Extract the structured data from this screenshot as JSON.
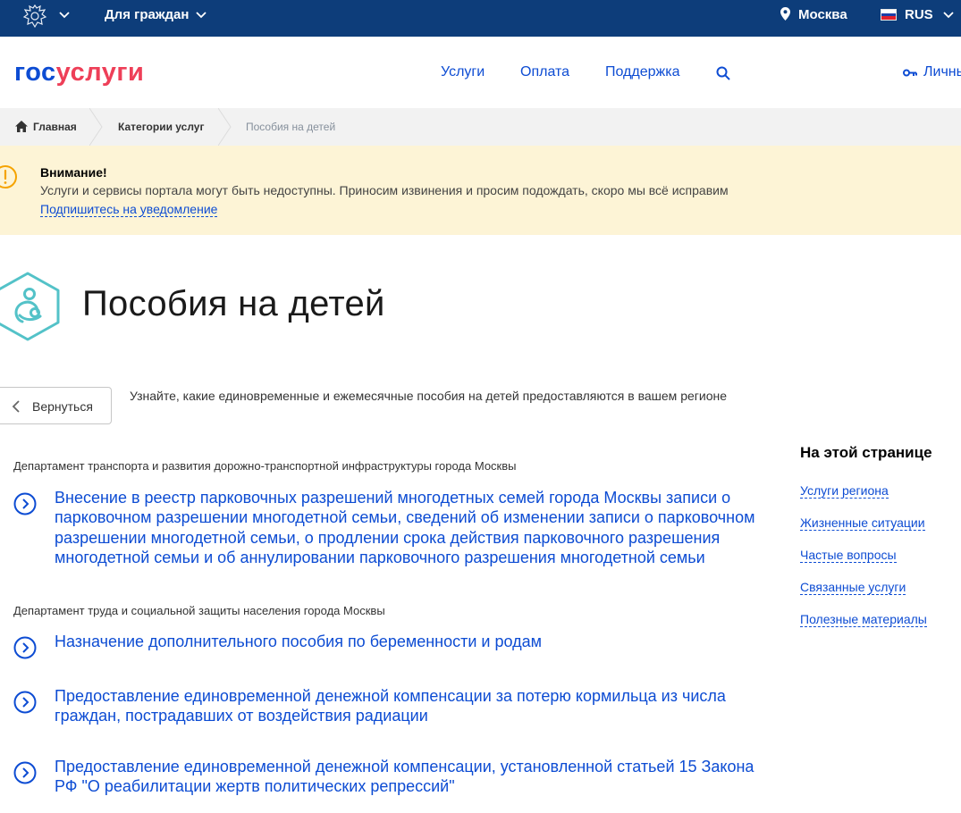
{
  "topbar": {
    "audience": "Для граждан",
    "location": "Москва",
    "language": "RUS",
    "flag_colors": [
      "#ffffff",
      "#1c3fa8",
      "#e2202c"
    ]
  },
  "header": {
    "logo_part1": "гос",
    "logo_part2": "услуги",
    "nav": {
      "services": "Услуги",
      "payment": "Оплата",
      "support": "Поддержка"
    },
    "personal": "Личный"
  },
  "breadcrumbs": {
    "home": "Главная",
    "categories": "Категории услуг",
    "current": "Пособия на детей"
  },
  "alert": {
    "title": "Внимание!",
    "text": "Услуги и сервисы портала могут быть недоступны. Приносим извинения и просим подождать, скоро мы всё исправим",
    "link": "Подпишитесь на уведомление"
  },
  "page": {
    "title": "Пособия на детей",
    "back_label": "Вернуться",
    "lead": "Узнайте, какие единовременные и ежемесячные пособия на детей предоставляются в вашем регионе"
  },
  "departments": [
    {
      "name": "Департамент транспорта и развития дорожно-транспортной инфраструктуры города Москвы",
      "services": [
        "Внесение в реестр парковочных разрешений многодетных семей города Москвы записи о парковочном разрешении многодетной семьи, сведений об изменении записи о парковочном разрешении многодетной семьи, о продлении срока действия парковочного разрешения многодетной семьи и об аннулировании парковочного разрешения многодетной семьи"
      ]
    },
    {
      "name": "Департамент труда и социальной защиты населения города Москвы",
      "services": [
        "Назначение дополнительного пособия по беременности и родам",
        "Предоставление единовременной денежной компенсации за потерю кормильца из числа граждан, пострадавших от воздействия радиации",
        "Предоставление единовременной денежной компенсации, установленной статьей 15 Закона РФ \"О реабилитации жертв политических репрессий\""
      ]
    }
  ],
  "aside": {
    "title": "На этой странице",
    "links": [
      "Услуги региона",
      "Жизненные ситуации",
      "Частые вопросы",
      "Связанные услуги",
      "Полезные материалы"
    ]
  },
  "colors": {
    "topbar": "#0d3d7a",
    "link": "#0d4cd3",
    "brand_red": "#ee3f58",
    "alert_bg": "#fdf4d6",
    "category_icon": "#53c2c8"
  },
  "icons": {
    "emblem": "coat-of-arms-icon",
    "location": "map-pin-icon",
    "search": "search-icon",
    "key": "key-icon",
    "home": "home-icon",
    "warning": "warning-circle-icon",
    "category": "mother-child-icon",
    "back": "chevron-left-icon",
    "service": "arrow-circle-icon"
  }
}
